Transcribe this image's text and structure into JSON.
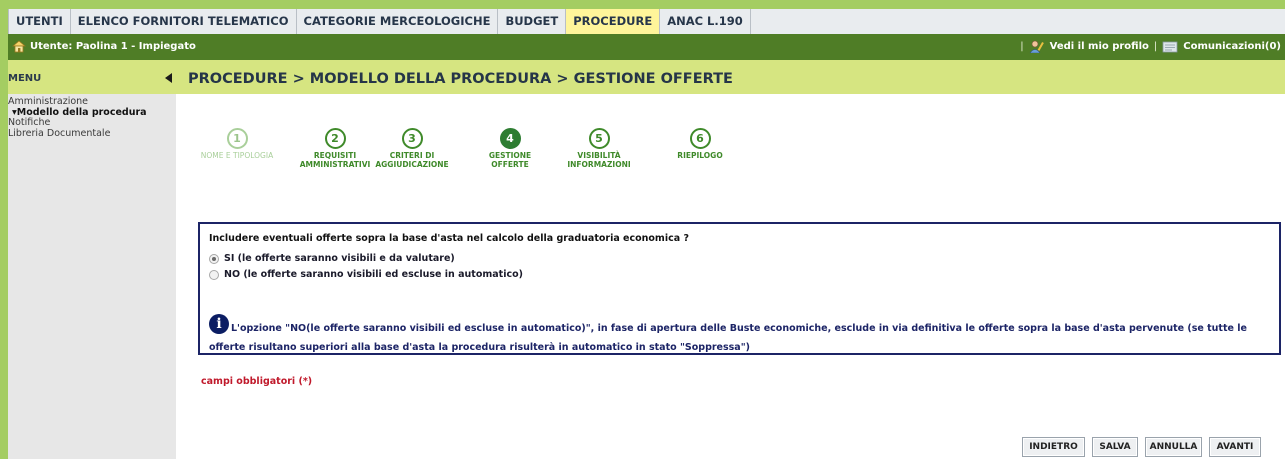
{
  "nav": {
    "items": [
      "UTENTI",
      "ELENCO FORNITORI TELEMATICO",
      "CATEGORIE MERCEOLOGICHE",
      "BUDGET",
      "PROCEDURE",
      "ANAC L.190"
    ],
    "active_index": 4
  },
  "userbar": {
    "user_label": "Utente: Paolina 1 - Impiegato",
    "profile_link": "Vedi il mio profilo",
    "messages_link": "Comunicazioni(0)",
    "separator": "|"
  },
  "sidebar": {
    "title": "MENU",
    "items": [
      "Amministrazione",
      "▾Modello della procedura",
      "Notifiche",
      "Libreria Documentale"
    ]
  },
  "breadcrumb": "PROCEDURE  > MODELLO DELLA PROCEDURA  > GESTIONE OFFERTE",
  "steps": [
    {
      "num": "1",
      "label": "NOME E TIPOLOGIA",
      "state": "done"
    },
    {
      "num": "2",
      "label": "REQUISITI AMMINISTRATIVI",
      "state": "todo"
    },
    {
      "num": "3",
      "label": "CRITERI DI AGGIUDICAZIONE",
      "state": "todo"
    },
    {
      "num": "4",
      "label": "GESTIONE OFFERTE",
      "state": "current"
    },
    {
      "num": "5",
      "label": "VISIBILITÀ INFORMAZIONI",
      "state": "todo"
    },
    {
      "num": "6",
      "label": "RIEPILOGO",
      "state": "todo"
    }
  ],
  "form": {
    "question": "Includere eventuali offerte sopra la base d'asta nel calcolo della graduatoria economica ?",
    "options": [
      {
        "label": "SI (le offerte saranno visibili e da valutare)",
        "checked": true
      },
      {
        "label": "NO (le offerte saranno visibili ed escluse in automatico)",
        "checked": false
      }
    ],
    "info": "L'opzione \"NO(le offerte saranno visibili ed escluse in automatico)\", in fase di apertura delle Buste economiche, esclude in via definitiva le offerte sopra la base d'asta pervenute (se tutte le offerte risultano superiori alla base d'asta la procedura risulterà in automatico in stato \"Soppressa\")"
  },
  "required_note": "campi obbligatori (*)",
  "buttons": {
    "back": "INDIETRO",
    "save": "SALVA",
    "cancel": "ANNULLA",
    "next": "AVANTI"
  },
  "colors": {
    "brand_green": "#a4cd62",
    "dark_green": "#4f7d26",
    "header_yellow": "#d6e581",
    "active_tab": "#fff59a",
    "step_green": "#3f8a2a",
    "box_border": "#1c2466",
    "required_red": "#c0192b"
  },
  "icons": {
    "user": "house-icon",
    "profile": "person-edit-icon",
    "messages": "envelope-icon",
    "menu_collapse": "triangle-left-icon",
    "info": "info-icon"
  }
}
